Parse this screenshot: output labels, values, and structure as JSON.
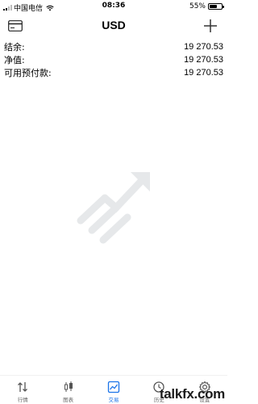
{
  "status_bar": {
    "carrier": "中国电信",
    "time": "08:36",
    "battery": "55%",
    "battery_level": 0.55
  },
  "header": {
    "title": "USD"
  },
  "account": {
    "rows": [
      {
        "label": "结余:",
        "value": "19 270.53"
      },
      {
        "label": "净值:",
        "value": "19 270.53"
      },
      {
        "label": "可用预付款:",
        "value": "19 270.53"
      }
    ]
  },
  "nav": {
    "items": [
      {
        "label": "行情",
        "icon": "quotes-arrows-icon"
      },
      {
        "label": "图表",
        "icon": "candlestick-icon"
      },
      {
        "label": "交易",
        "icon": "trade-chart-icon",
        "active": true
      },
      {
        "label": "历史",
        "icon": "history-clock-icon"
      },
      {
        "label": "设置",
        "icon": "settings-gear-icon"
      }
    ]
  },
  "watermark": "talkfx.com",
  "colors": {
    "accent": "#1a73e8",
    "empty_logo": "#e6e8ea"
  }
}
